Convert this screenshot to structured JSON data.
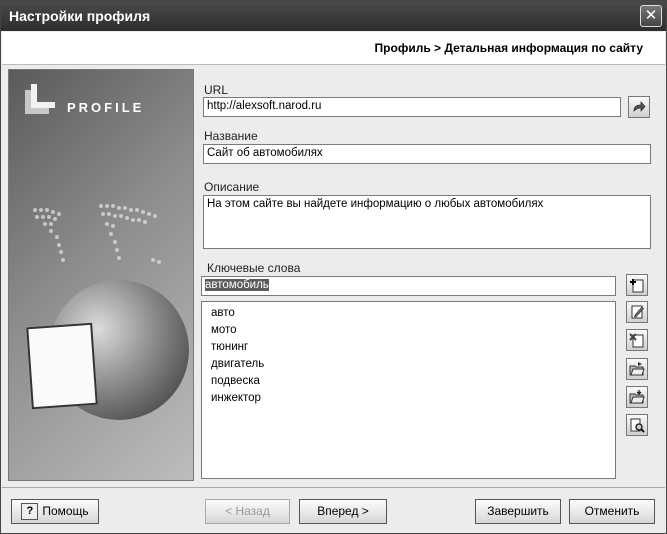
{
  "window": {
    "title": "Настройки профиля",
    "close_glyph": "✕"
  },
  "breadcrumb": "Профиль > Детальная информация по сайту",
  "banner": {
    "logo_text": "PROFILE"
  },
  "form": {
    "url_label": "URL",
    "url_value": "http://alexsoft.narod.ru",
    "name_label": "Название",
    "name_value": "Сайт об автомобилях",
    "desc_label": "Описание",
    "desc_value": "На этом сайте вы найдете информацию о любых автомобилях",
    "keywords_label": "Ключевые слова",
    "keyword_input": "автомобиль",
    "keywords": [
      "авто",
      "мото",
      "тюнинг",
      "двигатель",
      "подвеска",
      "инжектор"
    ]
  },
  "buttons": {
    "help": "Помощь",
    "back": "< Назад",
    "next": "Вперед >",
    "finish": "Завершить",
    "cancel": "Отменить"
  },
  "icons": {
    "go": "arrow-go-icon",
    "add": "add-keyword-icon",
    "edit": "edit-keyword-icon",
    "delete": "delete-keyword-icon",
    "open": "open-folder-icon",
    "save": "save-folder-icon",
    "search": "search-file-icon"
  }
}
